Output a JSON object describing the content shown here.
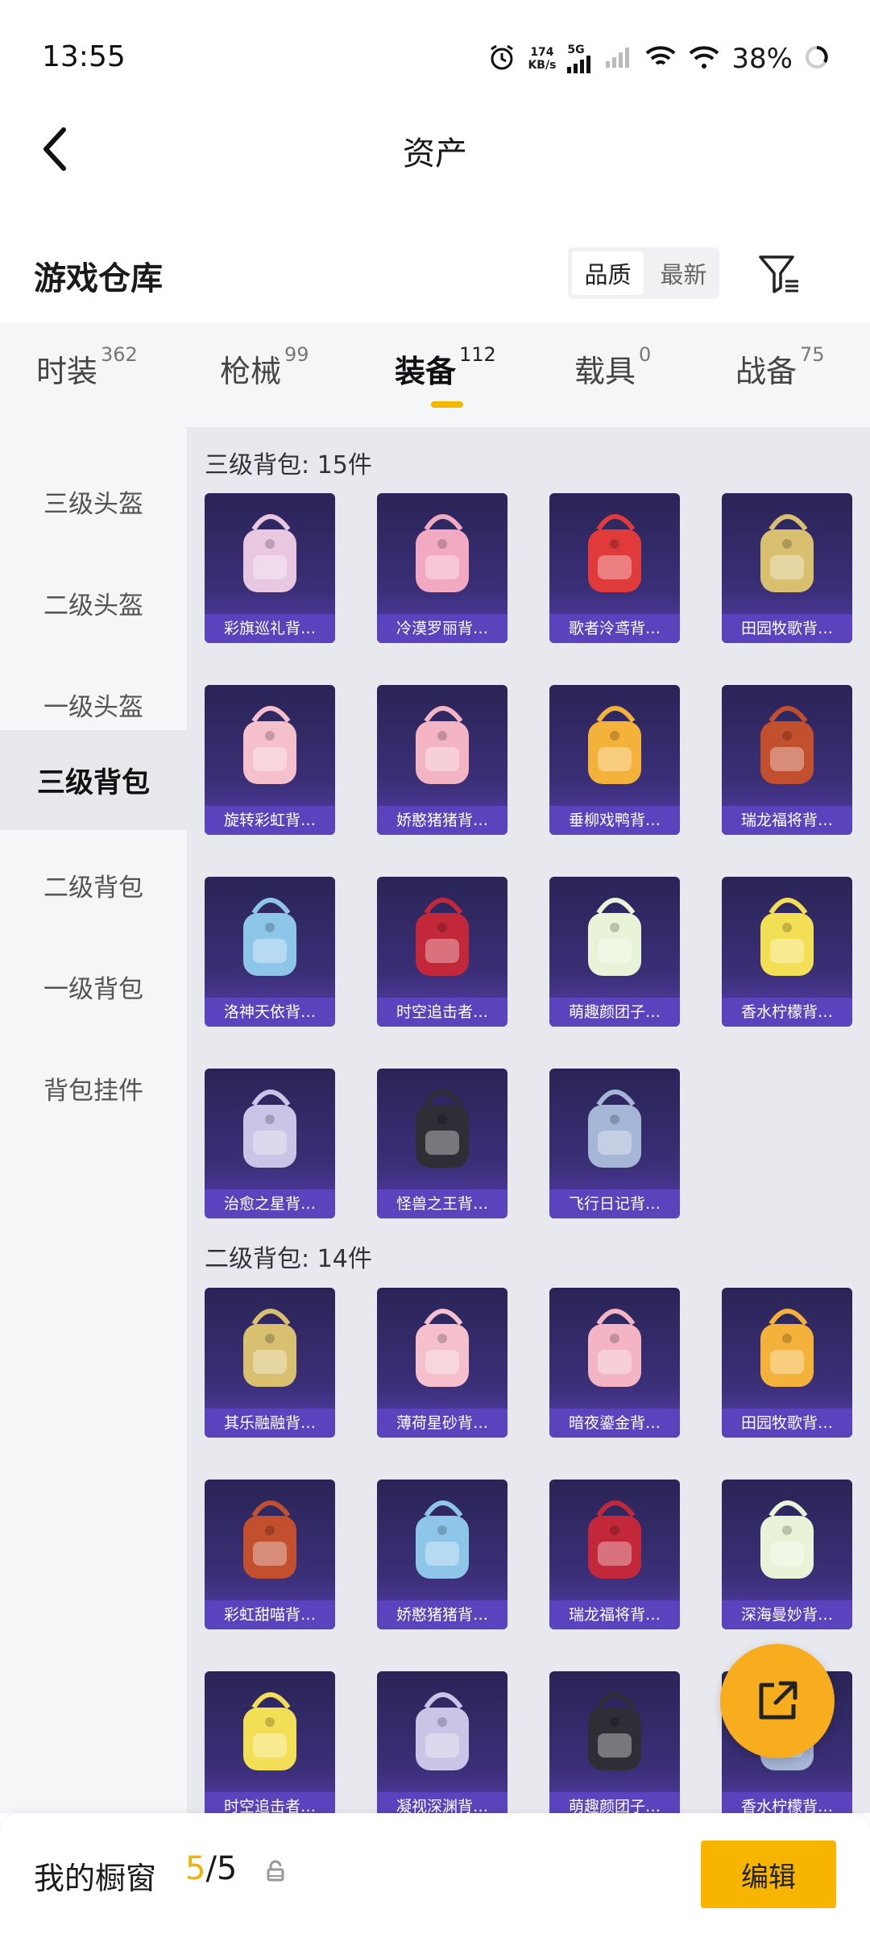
{
  "status_bar": {
    "time": "13:55",
    "speed_value": "174",
    "speed_unit": "KB/s",
    "network": "5G",
    "battery": "38%"
  },
  "nav": {
    "title": "资产"
  },
  "header": {
    "title": "游戏仓库",
    "sort_options": [
      "品质",
      "最新"
    ]
  },
  "tabs": [
    {
      "label": "时装",
      "count": "362"
    },
    {
      "label": "枪械",
      "count": "99"
    },
    {
      "label": "装备",
      "count": "112"
    },
    {
      "label": "载具",
      "count": "0"
    },
    {
      "label": "战备",
      "count": "75"
    }
  ],
  "sidebar": {
    "items": [
      "三级头盔",
      "二级头盔",
      "一级头盔",
      "三级背包",
      "二级背包",
      "一级背包",
      "背包挂件"
    ]
  },
  "sections": [
    {
      "title": "三级背包: 15件",
      "items": [
        "彩旗巡礼背…",
        "冷漠罗丽背…",
        "歌者泠鸢背…",
        "田园牧歌背…",
        "旋转彩虹背…",
        "娇憨猪猪背…",
        "垂柳戏鸭背…",
        "瑞龙福将背…",
        "洛神天依背…",
        "时空追击者…",
        "萌趣颜团子…",
        "香水柠檬背…",
        "治愈之星背…",
        "怪兽之王背…",
        "飞行日记背…"
      ]
    },
    {
      "title": "二级背包: 14件",
      "items": [
        "其乐融融背…",
        "薄荷星砂背…",
        "暗夜鎏金背…",
        "田园牧歌背…",
        "彩虹甜喵背…",
        "娇憨猪猪背…",
        "瑞龙福将背…",
        "深海曼妙背…",
        "时空追击者…",
        "凝视深渊背…",
        "萌趣颜团子…",
        "香水柠檬背…"
      ]
    }
  ],
  "bottom_bar": {
    "label": "我的橱窗",
    "count_current": "5",
    "count_sep": "/5",
    "edit": "编辑"
  },
  "colors": {
    "accent": "#f5b100",
    "item_label_bg": "#5b43bd",
    "item_bg": "#2a2456"
  }
}
